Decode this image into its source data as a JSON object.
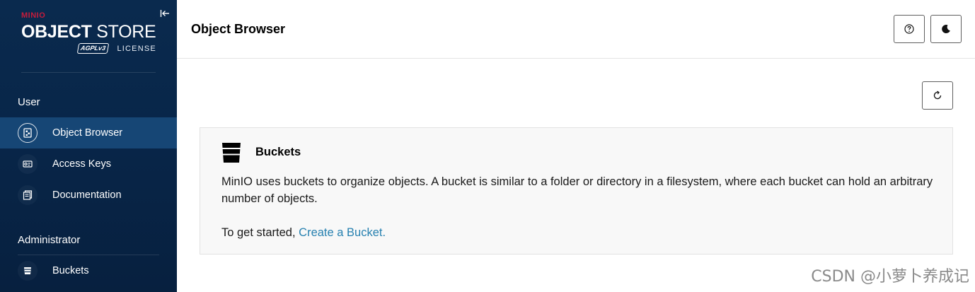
{
  "sidebar": {
    "brand": {
      "minio": "MINIO",
      "object": "OBJECT",
      "store": "STORE",
      "agpl": "AGPLv3",
      "license": "LICENSE"
    },
    "sections": [
      {
        "label": "User",
        "items": [
          {
            "label": "Object Browser",
            "icon": "object-browser-icon",
            "active": true
          },
          {
            "label": "Access Keys",
            "icon": "access-keys-icon",
            "active": false
          },
          {
            "label": "Documentation",
            "icon": "documentation-icon",
            "active": false
          }
        ]
      },
      {
        "label": "Administrator",
        "items": [
          {
            "label": "Buckets",
            "icon": "bucket-icon",
            "active": false
          }
        ]
      }
    ]
  },
  "header": {
    "title": "Object Browser",
    "help_icon": "help-icon",
    "theme_icon": "moon-icon"
  },
  "main": {
    "refresh_icon": "refresh-icon",
    "buckets_card": {
      "title": "Buckets",
      "description": "MinIO uses buckets to organize objects. A bucket is similar to a folder or directory in a filesystem, where each bucket can hold an arbitrary number of objects.",
      "cta_prefix": "To get started,",
      "cta_link": "Create a Bucket."
    }
  },
  "watermark": "CSDN @小萝卜养成记",
  "colors": {
    "sidebar_bg": "#082649",
    "sidebar_active": "#164675",
    "link": "#2781b0",
    "brand_red": "#c51c3c"
  }
}
